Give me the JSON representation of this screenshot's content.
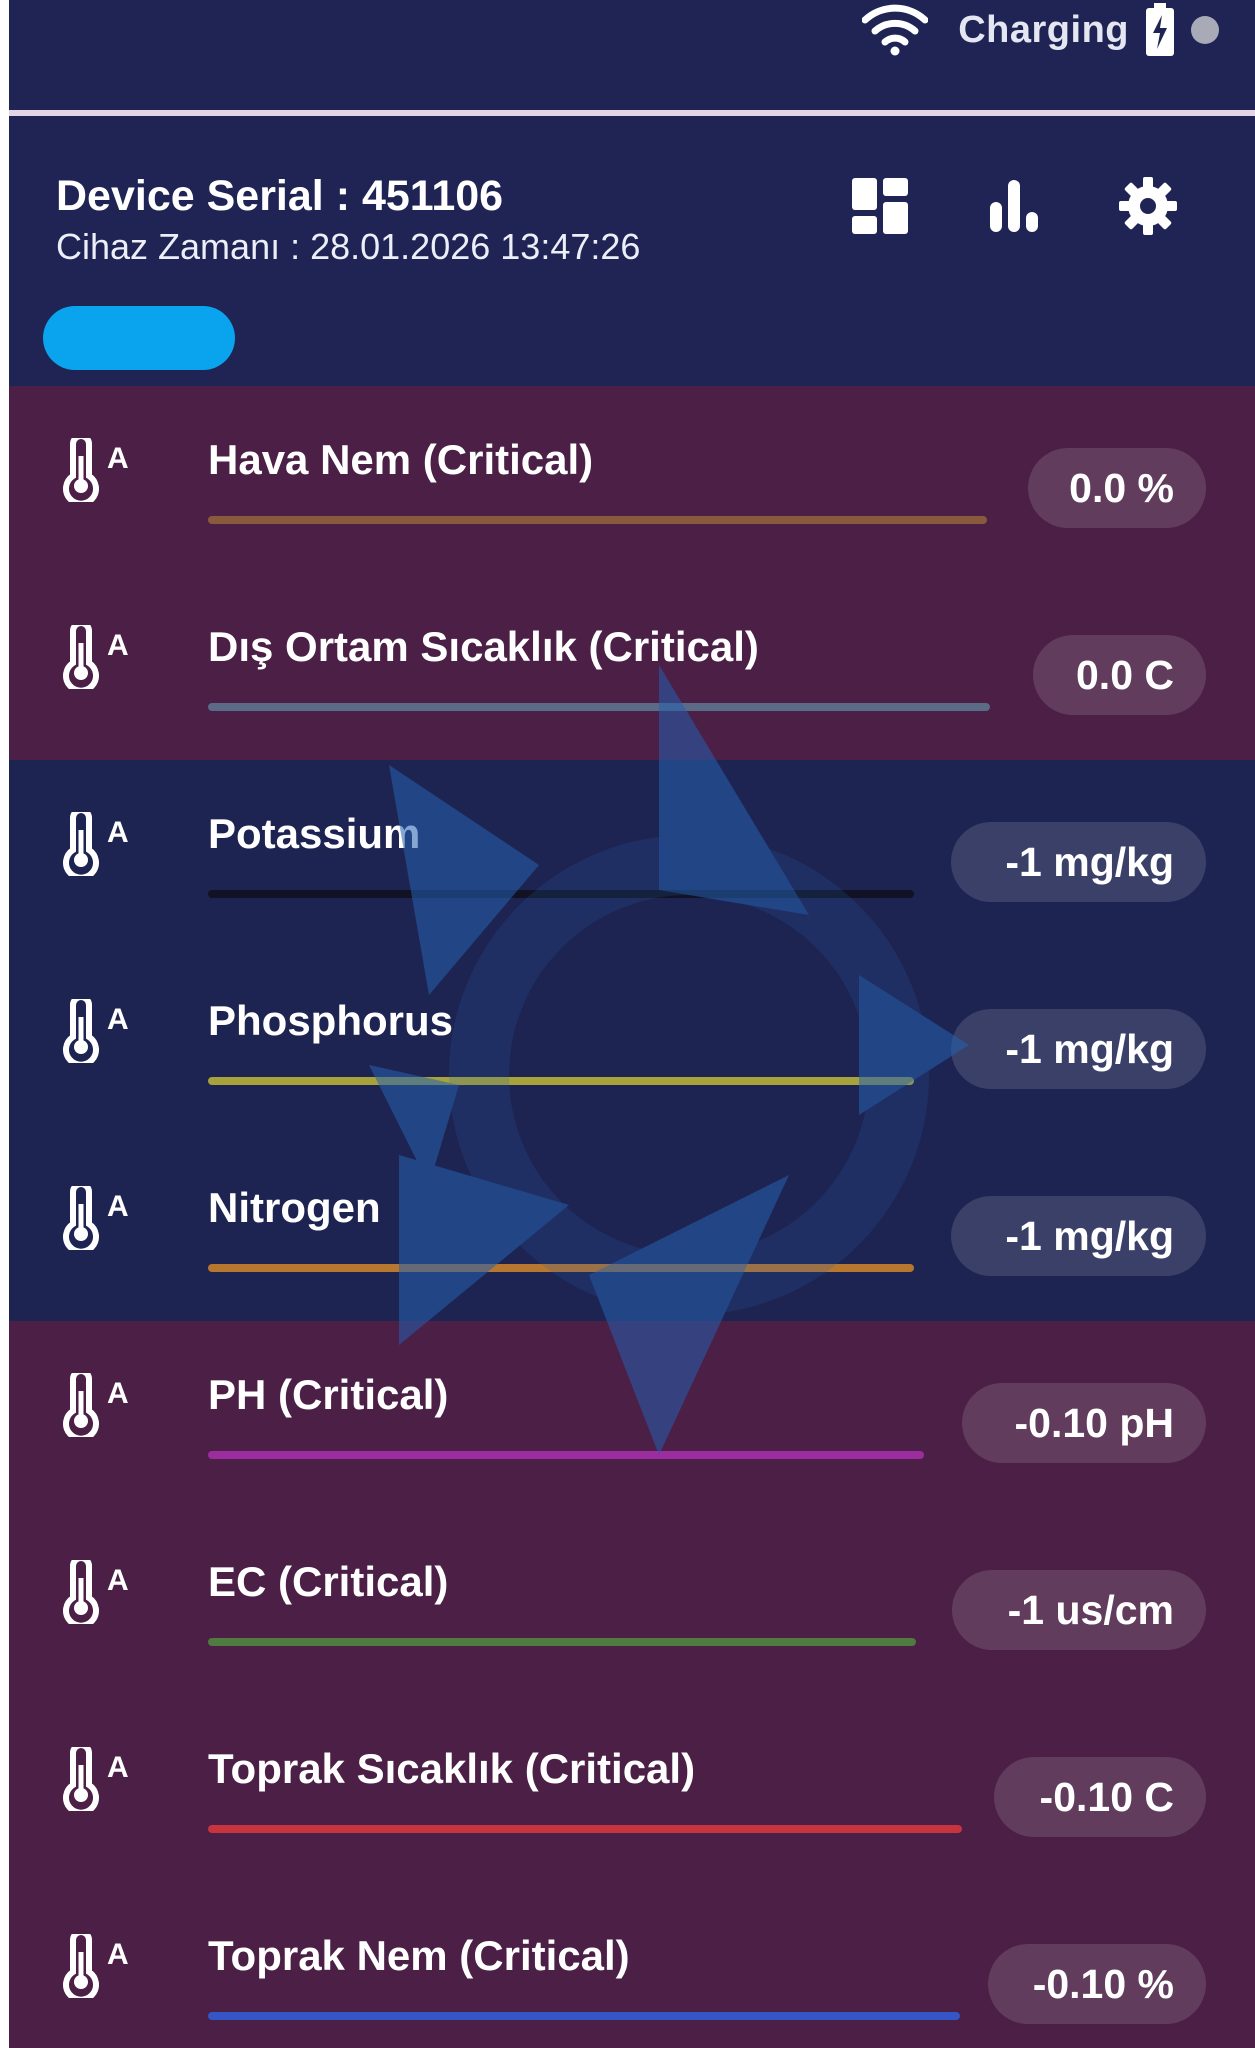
{
  "status_bar": {
    "wifi_icon": "wifi-icon",
    "charging_text": "Charging",
    "battery_icon": "battery-charging-icon",
    "dot_icon": "status-dot-icon"
  },
  "header": {
    "device_serial": "Device Serial : 451106",
    "device_time": "Cihaz Zamanı : 28.01.2026 13:47:26",
    "icons": [
      "dashboard-icon",
      "bar-chart-icon",
      "settings-gear-icon"
    ],
    "pill_color": "#0aa4ee"
  },
  "sensors": [
    {
      "label": "Hava Nem (Critical)",
      "value": "0.0 %",
      "status": "critical",
      "line_color": "#8a5a3c"
    },
    {
      "label": "Dış Ortam Sıcaklık (Critical)",
      "value": "0.0 C",
      "status": "critical",
      "line_color": "#5b6a86"
    },
    {
      "label": "Potassium",
      "value": "-1 mg/kg",
      "status": "normal",
      "line_color": "#111324"
    },
    {
      "label": "Phosphorus",
      "value": "-1 mg/kg",
      "status": "normal",
      "line_color": "#a7a23b"
    },
    {
      "label": "Nitrogen",
      "value": "-1 mg/kg",
      "status": "normal",
      "line_color": "#b7772f"
    },
    {
      "label": "PH (Critical)",
      "value": "-0.10 pH",
      "status": "critical",
      "line_color": "#9c2d9e"
    },
    {
      "label": "EC (Critical)",
      "value": "-1 us/cm",
      "status": "critical",
      "line_color": "#4f7a40"
    },
    {
      "label": "Toprak Sıcaklık (Critical)",
      "value": "-0.10 C",
      "status": "critical",
      "line_color": "#c7343e"
    },
    {
      "label": "Toprak Nem (Critical)",
      "value": "-0.10 %",
      "status": "critical",
      "line_color": "#3456c6"
    }
  ],
  "row_icon": "thermometer-auto-icon",
  "colors": {
    "background": "#1f2454",
    "critical_row": "#4b1f46",
    "normal_row": "#1e2452",
    "accent": "#0aa4ee"
  }
}
